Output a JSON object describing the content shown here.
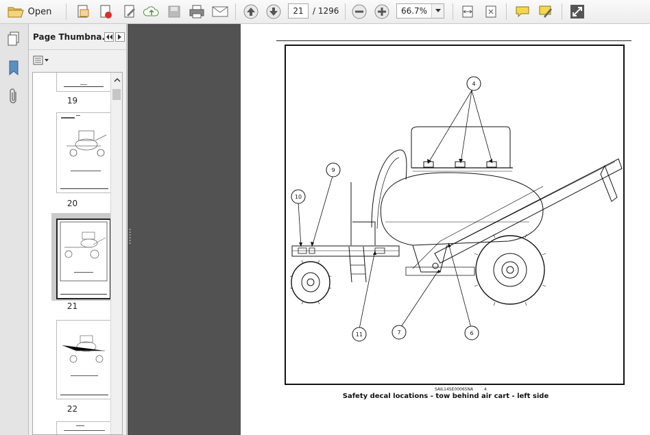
{
  "toolbar": {
    "open_label": "Open",
    "current_page": "21",
    "page_total": "/ 1296",
    "zoom": "66.7%",
    "icons": [
      "open-folder-icon",
      "create-pdf-icon",
      "export-pdf-icon",
      "edit-pdf-icon",
      "upload-cloud-icon",
      "save-icon",
      "print-icon",
      "email-icon",
      "page-up-icon",
      "page-down-icon",
      "zoom-out-icon",
      "zoom-in-icon",
      "fit-width-icon",
      "fit-page-icon",
      "comment-icon",
      "highlight-icon",
      "fullscreen-icon"
    ]
  },
  "panel": {
    "title": "Page Thumbna...",
    "thumbnails": [
      {
        "page": "19"
      },
      {
        "page": "20"
      },
      {
        "page": "21",
        "selected": true
      },
      {
        "page": "22"
      }
    ]
  },
  "document": {
    "callouts": [
      "4",
      "9",
      "10",
      "11",
      "7",
      "6"
    ],
    "figure_code": "SAIL14SE00065NA",
    "figure_ref": "4",
    "caption": "Safety decal locations - tow behind air cart - left side"
  },
  "colors": {
    "gutter": "#525252",
    "toolbar": "#f2f2f2",
    "panel": "#f0f0f0",
    "selected_thumb": "#cbcbcb"
  }
}
